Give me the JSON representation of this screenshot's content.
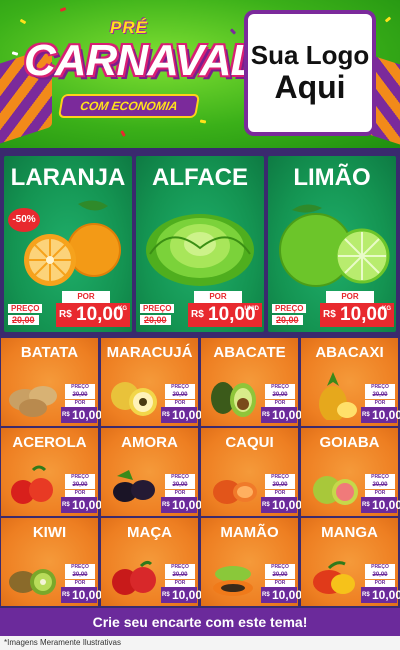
{
  "header": {
    "pre": "PRÉ",
    "title": "CARNAVAL",
    "subtitle": "COM ECONOMIA",
    "logo_line1": "Sua Logo",
    "logo_line2": "Aqui"
  },
  "featured": [
    {
      "name": "LARANJA",
      "discount": "-50%",
      "preco_label": "PREÇO",
      "old_price": "20,00",
      "por_label": "POR",
      "currency": "R$",
      "price": "10,00",
      "unit": "KG",
      "icon": "orange-icon"
    },
    {
      "name": "ALFACE",
      "preco_label": "PREÇO",
      "old_price": "20,00",
      "por_label": "POR",
      "currency": "R$",
      "price": "10,00",
      "unit": "UNID",
      "icon": "lettuce-icon"
    },
    {
      "name": "LIMÃO",
      "preco_label": "PREÇO",
      "old_price": "20,00",
      "por_label": "POR",
      "currency": "R$",
      "price": "10,00",
      "unit": "KG",
      "icon": "lime-icon"
    }
  ],
  "products": [
    {
      "name": "BATATA",
      "icon": "potato-icon"
    },
    {
      "name": "MARACUJÁ",
      "icon": "passionfruit-icon"
    },
    {
      "name": "ABACATE",
      "icon": "avocado-icon"
    },
    {
      "name": "ABACAXI",
      "icon": "pineapple-icon"
    },
    {
      "name": "ACEROLA",
      "icon": "acerola-icon"
    },
    {
      "name": "AMORA",
      "icon": "blackberry-icon"
    },
    {
      "name": "CAQUI",
      "icon": "persimmon-icon"
    },
    {
      "name": "GOIABA",
      "icon": "guava-icon"
    },
    {
      "name": "KIWI",
      "icon": "kiwi-icon"
    },
    {
      "name": "MAÇA",
      "icon": "apple-icon"
    },
    {
      "name": "MAMÃO",
      "icon": "papaya-icon"
    },
    {
      "name": "MANGA",
      "icon": "mango-icon"
    }
  ],
  "small_price": {
    "preco_label": "PREÇO",
    "old_price": "20,00",
    "por_label": "POR",
    "currency": "R$",
    "price": "10,00"
  },
  "footer": {
    "cta": "Crie seu encarte com este tema!",
    "disclaimer": "*Imagens Meramente Ilustrativas"
  },
  "colors": {
    "header_green": "#3bb019",
    "featured_green": "#149452",
    "grid_orange": "#ee7f22",
    "purple": "#6b2a9b",
    "price_red": "#e8292e"
  }
}
